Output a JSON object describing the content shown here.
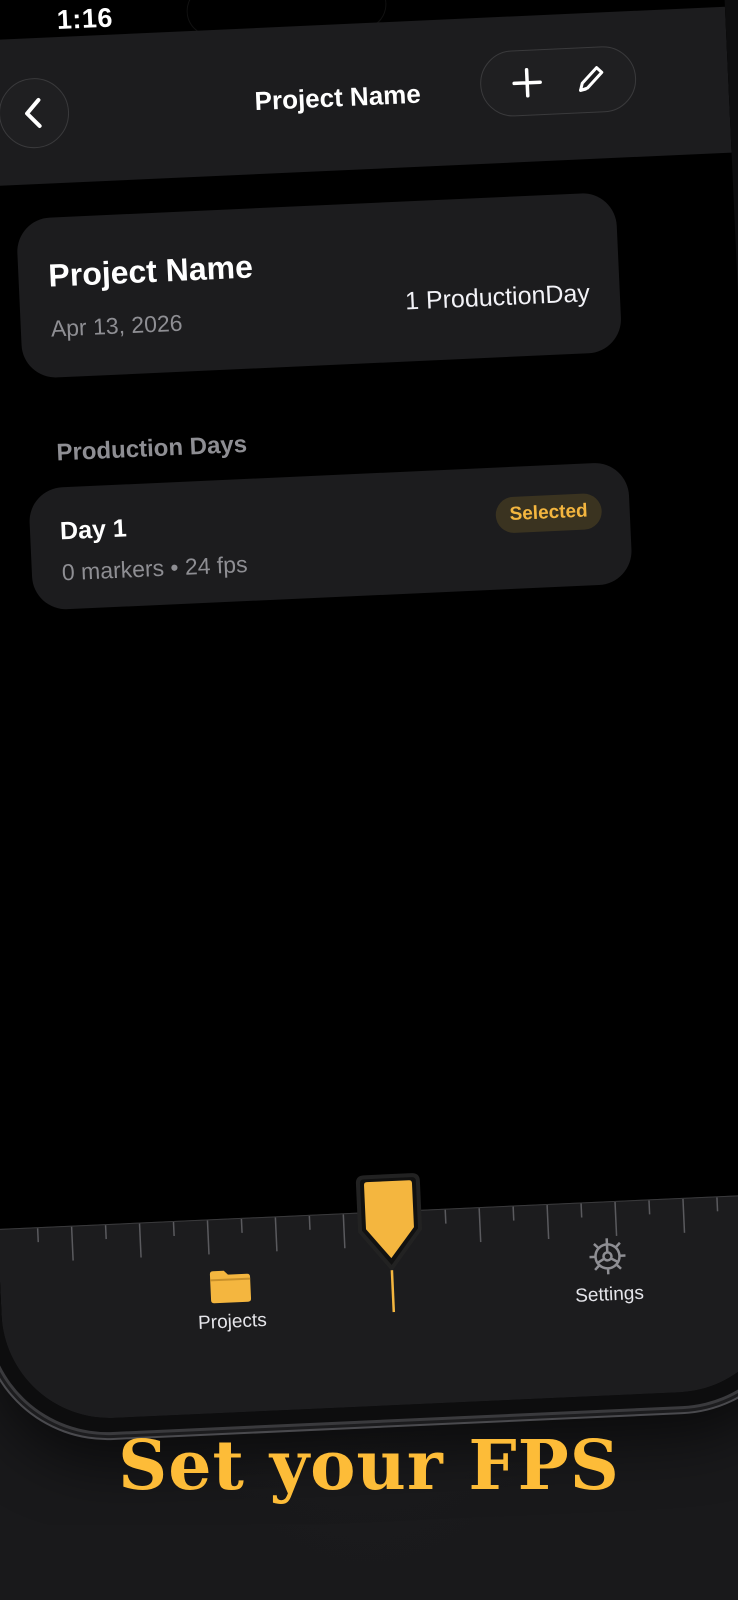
{
  "status_bar": {
    "time": "1:16"
  },
  "navbar": {
    "title": "Project Name",
    "back_icon": "chevron-left-icon",
    "add_icon": "plus-icon",
    "edit_icon": "pencil-icon"
  },
  "project": {
    "title": "Project Name",
    "date": "Apr 13, 2026",
    "count": "1 ProductionDay"
  },
  "production_days": {
    "header": "Production Days",
    "items": [
      {
        "title": "Day 1",
        "meta": "0 markers • 24 fps",
        "badge": "Selected"
      }
    ]
  },
  "tabbar": {
    "projects_label": "Projects",
    "projects_icon": "folder-icon",
    "marker_icon": "marker-pin-icon",
    "settings_label": "Settings",
    "settings_icon": "gear-icon"
  },
  "headline": "Set your FPS",
  "colors": {
    "accent": "#fdbc38",
    "card": "#1c1c1e",
    "badge_bg": "#3a3320",
    "secondary_text": "#8e8e93"
  }
}
